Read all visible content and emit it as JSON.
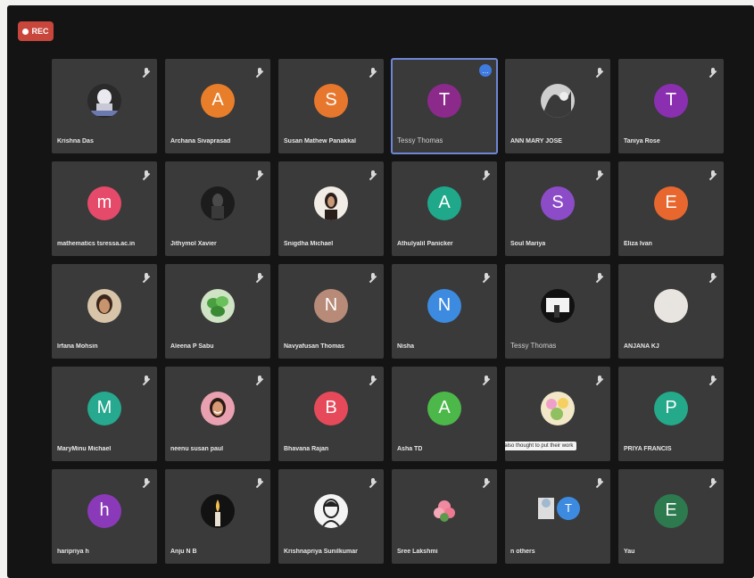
{
  "recording": {
    "label": "REC",
    "color": "#c8463c"
  },
  "tooltip": "He also thought to put their work",
  "others_badge": "T",
  "participants": [
    {
      "name": "Krishna Das",
      "kind": "photo",
      "photo": "ghost"
    },
    {
      "name": "Archana Sivaprasad",
      "kind": "letter",
      "letter": "A",
      "color": "#e87e2a"
    },
    {
      "name": "Susan Mathew Panakkal",
      "kind": "letter",
      "letter": "S",
      "color": "#e8772e"
    },
    {
      "name": "Tessy Thomas",
      "kind": "letter",
      "letter": "T",
      "color": "#8c2a8c",
      "active": true,
      "plain": true
    },
    {
      "name": "ANN MARY JOSE",
      "kind": "photo",
      "photo": "bw"
    },
    {
      "name": "Taniya Rose",
      "kind": "letter",
      "letter": "T",
      "color": "#8a2fb0"
    },
    {
      "name": "mathematics tsressa.ac.in",
      "kind": "letter",
      "letter": "m",
      "color": "#e64a6a"
    },
    {
      "name": "Jithymol Xavier",
      "kind": "photo",
      "photo": "dark"
    },
    {
      "name": "Snigdha Michael",
      "kind": "photo",
      "photo": "girl"
    },
    {
      "name": "Athulyalil Panicker",
      "kind": "letter",
      "letter": "A",
      "color": "#1fa98a"
    },
    {
      "name": "Soul Mariya",
      "kind": "letter",
      "letter": "S",
      "color": "#8c4cc8"
    },
    {
      "name": "Eliza Ivan",
      "kind": "letter",
      "letter": "E",
      "color": "#e8672e"
    },
    {
      "name": "Irfana Mohsin",
      "kind": "photo",
      "photo": "face"
    },
    {
      "name": "Aleena P Sabu",
      "kind": "photo",
      "photo": "plant"
    },
    {
      "name": "Navyafusan Thomas",
      "kind": "letter",
      "letter": "N",
      "color": "#b88a78"
    },
    {
      "name": "Nisha",
      "kind": "letter",
      "letter": "N",
      "color": "#3d8be0"
    },
    {
      "name": "Tessy Thomas",
      "kind": "photo",
      "photo": "screen",
      "plain": true
    },
    {
      "name": "ANJANA KJ",
      "kind": "letter",
      "letter": "",
      "color": "#e8e4df"
    },
    {
      "name": "MaryMinu Michael",
      "kind": "letter",
      "letter": "M",
      "color": "#26a98e"
    },
    {
      "name": "neenu susan paul",
      "kind": "photo",
      "photo": "smile"
    },
    {
      "name": "Bhavana Rajan",
      "kind": "letter",
      "letter": "B",
      "color": "#e64a5a"
    },
    {
      "name": "Asha TD",
      "kind": "letter",
      "letter": "A",
      "color": "#4cb84a"
    },
    {
      "name": "",
      "kind": "photo",
      "photo": "flower",
      "tooltip": true
    },
    {
      "name": "PRIYA FRANCIS",
      "kind": "letter",
      "letter": "P",
      "color": "#24a98a"
    },
    {
      "name": "haripriya h",
      "kind": "letter",
      "letter": "h",
      "color": "#8a3ab8"
    },
    {
      "name": "Anju N B",
      "kind": "photo",
      "photo": "candle"
    },
    {
      "name": "Krishnapriya Sunilkumar",
      "kind": "photo",
      "photo": "sketch"
    },
    {
      "name": "Sree Lakshmi",
      "kind": "photo",
      "photo": "pink"
    },
    {
      "name": "n others",
      "kind": "multi"
    },
    {
      "name": "Yau",
      "kind": "letter",
      "letter": "E",
      "color": "#2d7a4f"
    }
  ]
}
